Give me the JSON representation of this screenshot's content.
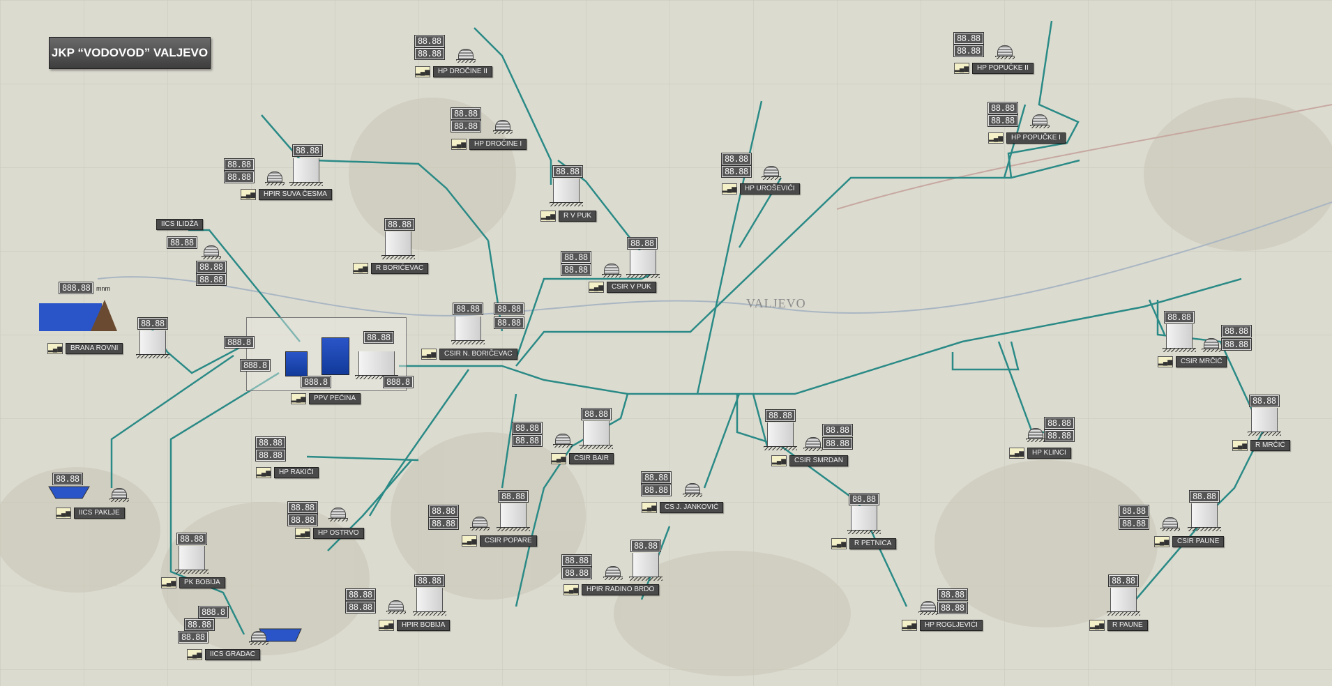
{
  "header": {
    "title": "JKP “VODOVOD” VALJEVO"
  },
  "map": {
    "city_label": "VALJEVO"
  },
  "units": {
    "flow": "l/s",
    "pressure": "bar",
    "level": "m",
    "elevation": "mnm"
  },
  "default_value": "88.88",
  "default_value_big": "888.8",
  "colors": {
    "pipe": "#2a8a86",
    "label_bg": "#4a4a4a",
    "display_bg": "#555555",
    "water": "#2a55c8"
  },
  "stations": [
    {
      "id": "brana",
      "label": "BRANA ROVNI",
      "level": "888.88",
      "level_unit": "mnm"
    },
    {
      "id": "ppv",
      "label": "PPV PEĆINA"
    },
    {
      "id": "iics-ilidza",
      "label": "IICS ILIDŽA"
    },
    {
      "id": "hpir-suva",
      "label": "HPIR SUVA ČESMA"
    },
    {
      "id": "r-boricevac",
      "label": "R BORIČEVAC"
    },
    {
      "id": "hp-drocine2",
      "label": "HP DROČINE II"
    },
    {
      "id": "hp-drocine1",
      "label": "HP DROČINE I"
    },
    {
      "id": "r-vpuk",
      "label": "R V PUK"
    },
    {
      "id": "csir-vpuk",
      "label": "CSIR V PUK"
    },
    {
      "id": "csir-nboricevac",
      "label": "CSIR N. BORIČEVAC"
    },
    {
      "id": "hp-urosevici",
      "label": "HP UROŠEVIĆI"
    },
    {
      "id": "hp-popucke2",
      "label": "HP POPUČKE II"
    },
    {
      "id": "hp-popucke1",
      "label": "HP POPUČKE I"
    },
    {
      "id": "csir-mrcic",
      "label": "CSIR MRČIĆ"
    },
    {
      "id": "r-mrcic",
      "label": "R MRČIĆ"
    },
    {
      "id": "hp-klinci",
      "label": "HP KLINCI"
    },
    {
      "id": "csir-smrdan",
      "label": "CSIR SMRDAN"
    },
    {
      "id": "r-petnica",
      "label": "R PETNICA"
    },
    {
      "id": "hp-rogljevici",
      "label": "HP ROGLJEVIĆI"
    },
    {
      "id": "csir-paune",
      "label": "CSIR PAUNE"
    },
    {
      "id": "r-paune",
      "label": "R PAUNE"
    },
    {
      "id": "csir-bair",
      "label": "CSIR BAIR"
    },
    {
      "id": "cs-jankovic",
      "label": "CS J. JANKOVIĆ"
    },
    {
      "id": "hpir-radino",
      "label": "HPIR RADINO BRDO"
    },
    {
      "id": "csir-popare",
      "label": "CSIR POPARE"
    },
    {
      "id": "hpir-bobija",
      "label": "HPIR BOBIJA"
    },
    {
      "id": "hp-rakici",
      "label": "HP RAKIĆI"
    },
    {
      "id": "hp-ostrvo",
      "label": "HP OSTRVO"
    },
    {
      "id": "iics-paklje",
      "label": "IICS PAKLJE"
    },
    {
      "id": "pk-bobija",
      "label": "PK BOBIJA"
    },
    {
      "id": "iics-gradac",
      "label": "IICS GRADAC"
    }
  ]
}
